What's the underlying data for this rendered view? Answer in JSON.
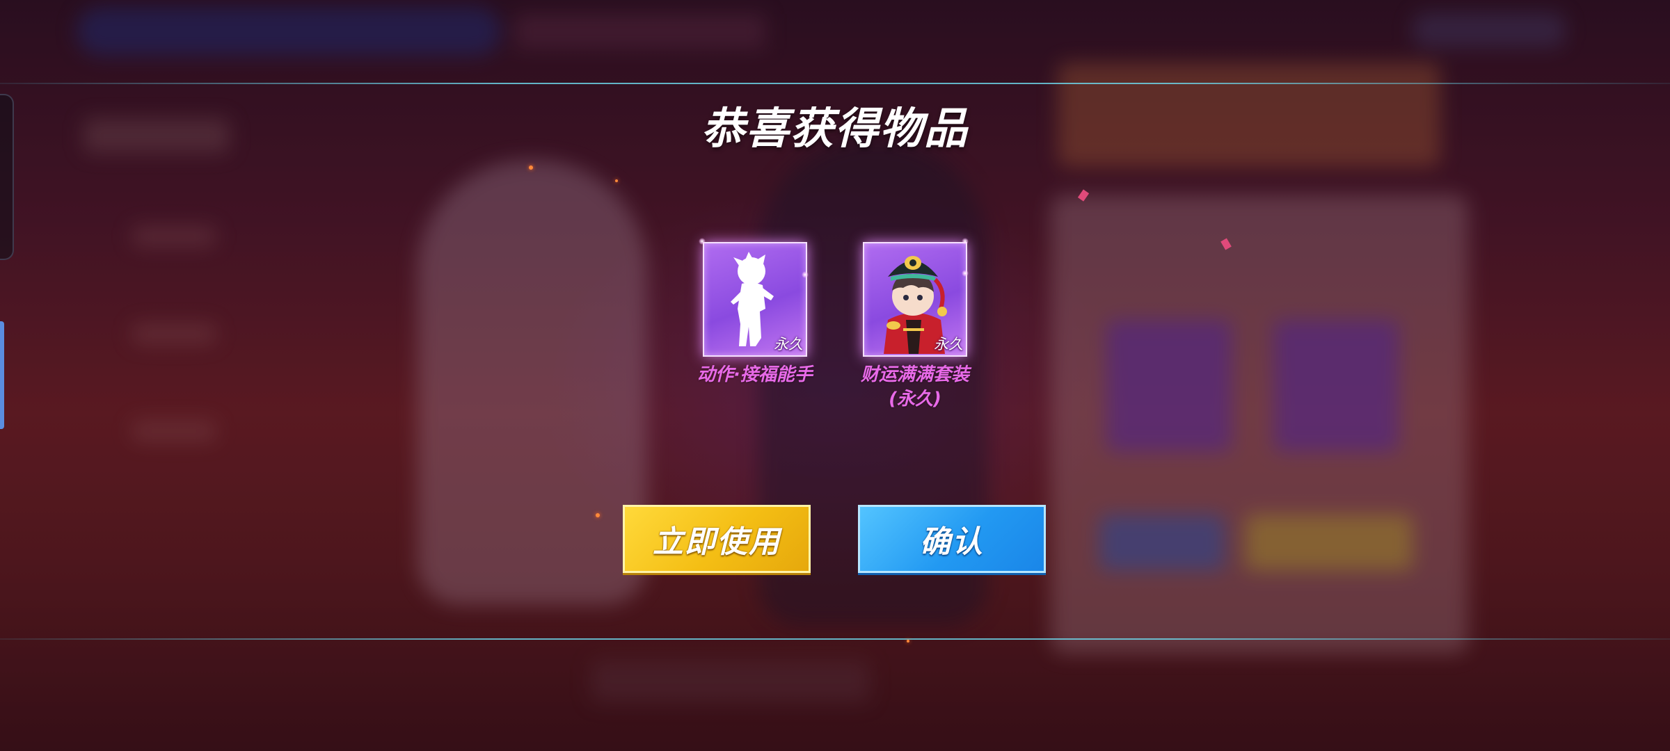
{
  "dialog": {
    "title": "恭喜获得物品"
  },
  "rewards": [
    {
      "name": "动作·接福能手",
      "duration_badge": "永久",
      "icon": "silhouette-pose-icon"
    },
    {
      "name": "财运满满套装\n(永久)",
      "duration_badge": "永久",
      "icon": "character-outfit-icon"
    }
  ],
  "buttons": {
    "use_now_label": "立即使用",
    "confirm_label": "确认"
  },
  "colors": {
    "reward_name": "#e86ae8",
    "use_button": "#f4be14",
    "confirm_button": "#2299f2",
    "card_purple": "#8a4ae0"
  }
}
